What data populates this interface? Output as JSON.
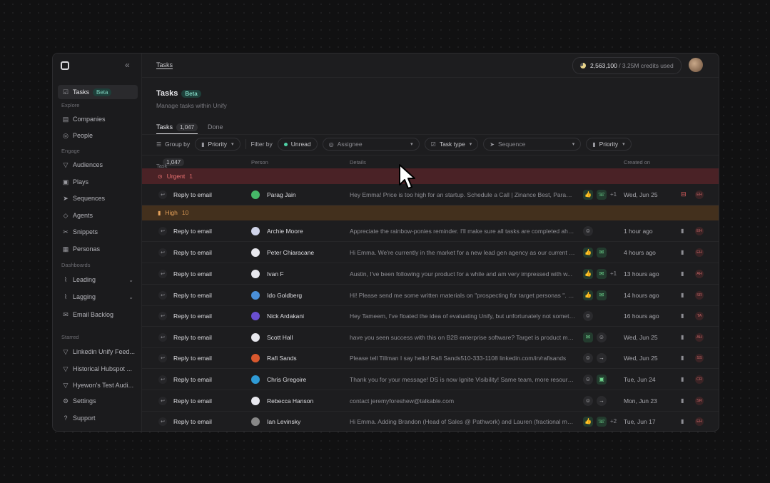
{
  "sidebar": {
    "collapse_icon": "«",
    "items": [
      {
        "label": "Tasks",
        "icon": "checkbox-icon",
        "glyph": "☑",
        "badge": "Beta",
        "active": true
      },
      {
        "label": "Companies",
        "icon": "building-icon",
        "glyph": "▤"
      },
      {
        "label": "People",
        "icon": "person-icon",
        "glyph": "◎"
      },
      {
        "label": "Audiences",
        "icon": "funnel-icon",
        "glyph": "▽"
      },
      {
        "label": "Plays",
        "icon": "plays-icon",
        "glyph": "▣"
      },
      {
        "label": "Sequences",
        "icon": "send-icon",
        "glyph": "➤"
      },
      {
        "label": "Agents",
        "icon": "agent-icon",
        "glyph": "◇"
      },
      {
        "label": "Snippets",
        "icon": "scissors-icon",
        "glyph": "✂"
      },
      {
        "label": "Personas",
        "icon": "grid-icon",
        "glyph": "▦"
      },
      {
        "label": "Leading",
        "icon": "chart-line-icon",
        "glyph": "⌇"
      },
      {
        "label": "Lagging",
        "icon": "chart-line-icon",
        "glyph": "⌇"
      },
      {
        "label": "Email Backlog",
        "icon": "email-icon",
        "glyph": "✉"
      },
      {
        "label": "Linkedin Unify Feed...",
        "icon": "funnel-icon",
        "glyph": "▽"
      },
      {
        "label": "Historical Hubspot ...",
        "icon": "funnel-icon",
        "glyph": "▽"
      },
      {
        "label": "Hyewon's Test Audi...",
        "icon": "funnel-icon",
        "glyph": "▽"
      },
      {
        "label": "Settings",
        "icon": "gear-icon",
        "glyph": "⚙"
      },
      {
        "label": "Support",
        "icon": "help-icon",
        "glyph": "?"
      }
    ],
    "sections": {
      "explore": "Explore",
      "engage": "Engage",
      "dashboards": "Dashboards",
      "starred": "Starred"
    }
  },
  "topbar": {
    "breadcrumb": "Tasks",
    "credits_used": "2,563,100",
    "credits_total": "/ 3.25M credits used"
  },
  "page": {
    "title": "Tasks",
    "title_badge": "Beta",
    "subtitle": "Manage tasks within Unify",
    "tabs": [
      {
        "label": "Tasks",
        "count": "1,047"
      },
      {
        "label": "Done"
      }
    ]
  },
  "toolbar": {
    "group_by": "Group by",
    "group_value": "Priority",
    "filter_by": "Filter by",
    "unread": "Unread",
    "assignee": "Assignee",
    "task_type": "Task type",
    "sequence": "Sequence",
    "priority": "Priority"
  },
  "table": {
    "headers": {
      "task": "Task",
      "task_count": "1,047",
      "person": "Person",
      "details": "Details",
      "created": "Created on"
    },
    "groups": {
      "urgent": {
        "label": "Urgent",
        "count": "1"
      },
      "high": {
        "label": "High",
        "count": "10"
      }
    },
    "rows": [
      {
        "task": "Reply to email",
        "person": "Parag Jain",
        "details": "Hey Emma! Price is too high for an startup. Schedule a Call | Zinance Best, Parag ...",
        "created": "Wed, Jun 25",
        "owner": "EH",
        "more": "+1",
        "acts": [
          "👍",
          "☏"
        ]
      },
      {
        "task": "Reply to email",
        "person": "Archie Moore",
        "details": "Appreciate the rainbow-ponies reminder. I'll make sure all tasks are completed ahead of ti...",
        "created": "1 hour ago",
        "owner": "EH",
        "acts": [
          "☺"
        ]
      },
      {
        "task": "Reply to email",
        "person": "Peter Chiaracane",
        "details": "Hi Emma. We're currently in the market for a new lead gen agency as our current ven...",
        "created": "4 hours ago",
        "owner": "EH",
        "acts": [
          "👍",
          "✉"
        ]
      },
      {
        "task": "Reply to email",
        "person": "Ivan F",
        "details": "Austin, I've been following your product for a while and am very impressed with w...",
        "created": "13 hours ago",
        "owner": "AH",
        "more": "+1",
        "acts": [
          "👍",
          "✉"
        ]
      },
      {
        "task": "Reply to email",
        "person": "Ido Goldberg",
        "details": "Hi! Please send me some written materials on \"prospecting for target personas \". Th...",
        "created": "14 hours ago",
        "owner": "SR",
        "acts": [
          "👍",
          "✉"
        ]
      },
      {
        "task": "Reply to email",
        "person": "Nick Ardakani",
        "details": "Hey Tameem, I've floated the idea of evaluating Unify, but unfortunately not something our ...",
        "created": "16 hours ago",
        "owner": "TA",
        "acts": [
          "☺"
        ]
      },
      {
        "task": "Reply to email",
        "person": "Scott Hall",
        "details": "have you seen success with this on B2B enterprise software? Target is product man...",
        "created": "Wed, Jun 25",
        "owner": "AH",
        "acts": [
          "✉",
          "☺"
        ]
      },
      {
        "task": "Reply to email",
        "person": "Rafi Sands",
        "details": "Please tell Tillman I say hello! Rafi Sands510-333-1108 linkedin.com/in/rafisands",
        "created": "Wed, Jun 25",
        "owner": "SS",
        "acts": [
          "☺",
          "→"
        ]
      },
      {
        "task": "Reply to email",
        "person": "Chris Gregoire",
        "details": "Thank you for your message! DS is now Ignite Visibility! Same team, more resources,...",
        "created": "Tue, Jun 24",
        "owner": "CR",
        "acts": [
          "☺",
          "▣"
        ]
      },
      {
        "task": "Reply to email",
        "person": "Rebecca Hanson",
        "details": "contact jeremyforeshew@talkable.com",
        "created": "Mon, Jun 23",
        "owner": "SR",
        "acts": [
          "☺",
          "→"
        ]
      },
      {
        "task": "Reply to email",
        "person": "Ian Levinsky",
        "details": "Hi Emma. Adding Brandon (Head of Sales @ Pathwork) and Lauren (fractional ma...",
        "created": "Tue, Jun 17",
        "owner": "EH",
        "more": "+2",
        "acts": [
          "👍",
          "☏"
        ]
      }
    ]
  },
  "colors": {
    "urgent": "#4a2226",
    "high": "#43301d",
    "accent": "#4fd1a6"
  },
  "avatar_colors": [
    "#46b868",
    "#cfd3e8",
    "#e8e8ee",
    "#e8e8ee",
    "#4a8fd8",
    "#6a4fd0",
    "#e8e8ee",
    "#d8582e",
    "#2f9bd6",
    "#e8e8ee",
    "#888"
  ]
}
